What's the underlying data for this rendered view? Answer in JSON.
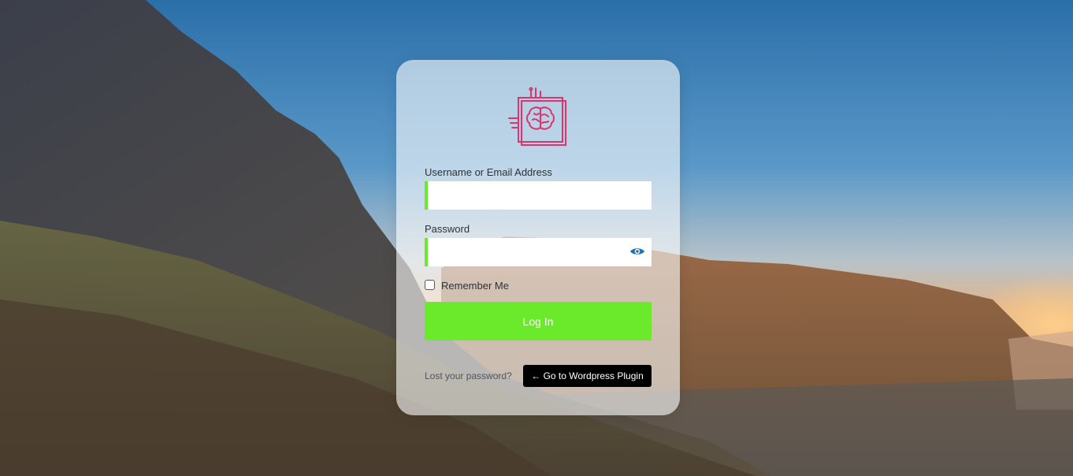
{
  "login": {
    "username_label": "Username or Email Address",
    "username_value": "",
    "password_label": "Password",
    "password_value": "",
    "remember_label": "Remember Me",
    "login_button": "Log In",
    "lost_password": "Lost your password?",
    "goto_plugin": "← Go to Wordpress Plugin"
  },
  "icons": {
    "logo": "brain-chip-logo-icon",
    "show_password": "eye-icon"
  },
  "colors": {
    "accent": "#6bea2b",
    "logo": "#e0336e",
    "eye": "#2271b1",
    "goto_button_bg": "#000000"
  }
}
